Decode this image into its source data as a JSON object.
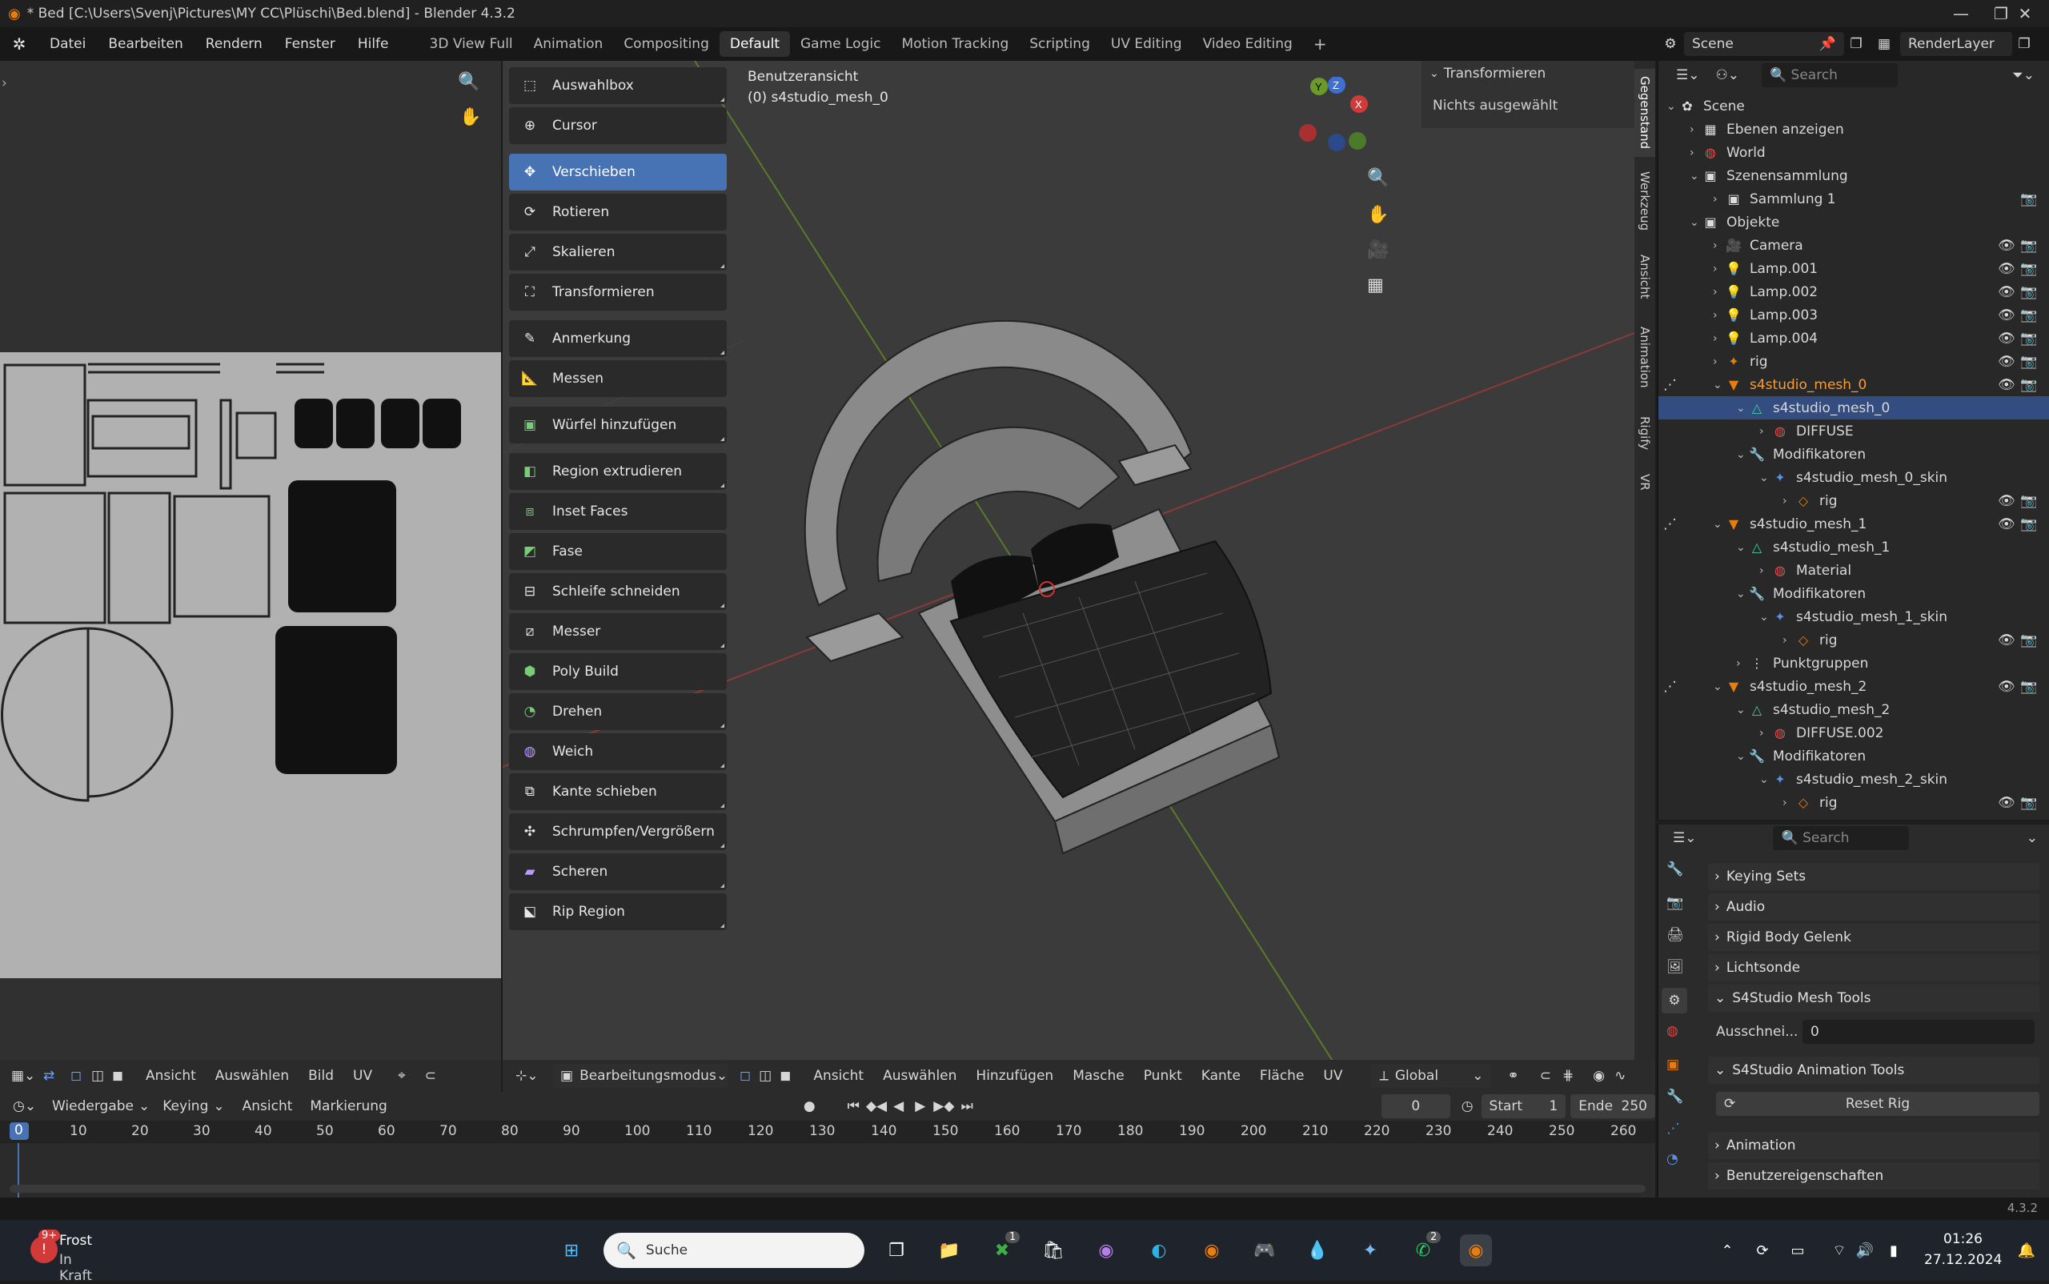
{
  "title_bar": {
    "text": "* Bed [C:\\Users\\Svenj\\Pictures\\MY CC\\Plüschi\\Bed.blend] - Blender 4.3.2"
  },
  "menu": [
    "Datei",
    "Bearbeiten",
    "Rendern",
    "Fenster",
    "Hilfe"
  ],
  "workspaces": [
    "3D View Full",
    "Animation",
    "Compositing",
    "Default",
    "Game Logic",
    "Motion Tracking",
    "Scripting",
    "UV Editing",
    "Video Editing"
  ],
  "active_workspace": "Default",
  "scene": {
    "name": "Scene",
    "render_layer": "RenderLayer"
  },
  "viewport": {
    "view_name": "Benutzeransicht",
    "object_info": "(0) s4studio_mesh_0",
    "n_panel_title": "Transformieren",
    "n_panel_text": "Nichts ausgewählt",
    "side_tabs": [
      "Gegenstand",
      "Werkzeug",
      "Ansicht",
      "Animation",
      "Rigify",
      "VR"
    ]
  },
  "tools": [
    {
      "label": "Auswahlbox",
      "icon": "select-box-icon"
    },
    {
      "label": "Cursor",
      "icon": "cursor-icon"
    },
    {
      "label": "Verschieben",
      "icon": "move-icon",
      "active": true
    },
    {
      "label": "Rotieren",
      "icon": "rotate-icon"
    },
    {
      "label": "Skalieren",
      "icon": "scale-icon"
    },
    {
      "label": "Transformieren",
      "icon": "transform-icon"
    },
    {
      "label": "Anmerkung",
      "icon": "annotate-icon"
    },
    {
      "label": "Messen",
      "icon": "measure-icon"
    },
    {
      "label": "Würfel hinzufügen",
      "icon": "add-cube-icon"
    },
    {
      "label": "Region extrudieren",
      "icon": "extrude-icon"
    },
    {
      "label": "Inset Faces",
      "icon": "inset-icon"
    },
    {
      "label": "Fase",
      "icon": "bevel-icon"
    },
    {
      "label": "Schleife schneiden",
      "icon": "loop-cut-icon"
    },
    {
      "label": "Messer",
      "icon": "knife-icon"
    },
    {
      "label": "Poly Build",
      "icon": "poly-build-icon"
    },
    {
      "label": "Drehen",
      "icon": "spin-icon"
    },
    {
      "label": "Weich",
      "icon": "smooth-icon"
    },
    {
      "label": "Kante schieben",
      "icon": "edge-slide-icon"
    },
    {
      "label": "Schrumpfen/Vergrößern",
      "icon": "shrink-fatten-icon"
    },
    {
      "label": "Scheren",
      "icon": "shear-icon"
    },
    {
      "label": "Rip Region",
      "icon": "rip-region-icon"
    }
  ],
  "uv_header": {
    "items": [
      "Ansicht",
      "Auswählen",
      "Bild",
      "UV"
    ]
  },
  "viewport_header": {
    "mode": "Bearbeitungsmodus",
    "items": [
      "Ansicht",
      "Auswählen",
      "Hinzufügen",
      "Masche",
      "Punkt",
      "Kante",
      "Fläche",
      "UV"
    ],
    "orientation": "Global"
  },
  "outliner": {
    "search_placeholder": "Search",
    "rows": [
      {
        "label": "Scene",
        "indent": 0,
        "icon": "scene"
      },
      {
        "label": "Ebenen anzeigen",
        "indent": 1,
        "icon": "layers"
      },
      {
        "label": "World",
        "indent": 1,
        "icon": "world"
      },
      {
        "label": "Szenensammlung",
        "indent": 1,
        "icon": "collection"
      },
      {
        "label": "Sammlung 1",
        "indent": 2,
        "icon": "collection"
      },
      {
        "label": "Objekte",
        "indent": 1,
        "icon": "collection"
      },
      {
        "label": "Camera",
        "indent": 2,
        "icon": "camera"
      },
      {
        "label": "Lamp.001",
        "indent": 2,
        "icon": "lamp"
      },
      {
        "label": "Lamp.002",
        "indent": 2,
        "icon": "lamp"
      },
      {
        "label": "Lamp.003",
        "indent": 2,
        "icon": "lamp"
      },
      {
        "label": "Lamp.004",
        "indent": 2,
        "icon": "lamp"
      },
      {
        "label": "rig",
        "indent": 2,
        "icon": "armature"
      },
      {
        "label": "s4studio_mesh_0",
        "indent": 2,
        "icon": "mesh",
        "highlight": true
      },
      {
        "label": "s4studio_mesh_0",
        "indent": 3,
        "icon": "meshdata",
        "selected": true
      },
      {
        "label": "DIFFUSE",
        "indent": 4,
        "icon": "material"
      },
      {
        "label": "Modifikatoren",
        "indent": 3,
        "icon": "wrench"
      },
      {
        "label": "s4studio_mesh_0_skin",
        "indent": 4,
        "icon": "modifier"
      },
      {
        "label": "rig",
        "indent": 5,
        "icon": "armdata"
      },
      {
        "label": "s4studio_mesh_1",
        "indent": 2,
        "icon": "mesh"
      },
      {
        "label": "s4studio_mesh_1",
        "indent": 3,
        "icon": "meshdata"
      },
      {
        "label": "Material",
        "indent": 4,
        "icon": "material"
      },
      {
        "label": "Modifikatoren",
        "indent": 3,
        "icon": "wrench"
      },
      {
        "label": "s4studio_mesh_1_skin",
        "indent": 4,
        "icon": "modifier"
      },
      {
        "label": "rig",
        "indent": 5,
        "icon": "armdata"
      },
      {
        "label": "Punktgruppen",
        "indent": 3,
        "icon": "groups"
      },
      {
        "label": "s4studio_mesh_2",
        "indent": 2,
        "icon": "mesh"
      },
      {
        "label": "s4studio_mesh_2",
        "indent": 3,
        "icon": "meshdata"
      },
      {
        "label": "DIFFUSE.002",
        "indent": 4,
        "icon": "material"
      },
      {
        "label": "Modifikatoren",
        "indent": 3,
        "icon": "wrench"
      },
      {
        "label": "s4studio_mesh_2_skin",
        "indent": 4,
        "icon": "modifier"
      },
      {
        "label": "rig",
        "indent": 5,
        "icon": "armdata"
      }
    ]
  },
  "properties": {
    "search_placeholder": "Search",
    "panels": [
      "Keying Sets",
      "Audio",
      "Rigid Body Gelenk",
      "Lichtsonde",
      "S4Studio Mesh Tools",
      "S4Studio Animation Tools",
      "Animation",
      "Benutzereigenschaften"
    ],
    "cut_label": "Ausschnei...",
    "cut_value": "0",
    "reset_rig": "Reset Rig"
  },
  "timeline": {
    "items": [
      "Wiedergabe",
      "Keying",
      "Ansicht",
      "Markierung"
    ],
    "current_frame": "0",
    "start_label": "Start",
    "start": "1",
    "end_label": "Ende",
    "end": "250",
    "ticks": [
      "0",
      "10",
      "20",
      "30",
      "40",
      "50",
      "60",
      "70",
      "80",
      "90",
      "100",
      "110",
      "120",
      "130",
      "140",
      "150",
      "160",
      "170",
      "180",
      "190",
      "200",
      "210",
      "220",
      "230",
      "240",
      "250",
      "260"
    ]
  },
  "status": {
    "version": "4.3.2"
  },
  "taskbar": {
    "weather_title": "Frost",
    "weather_sub": "In Kraft",
    "weather_badge": "9+",
    "search_placeholder": "Suche",
    "xbox_badge": "1",
    "whatsapp_badge": "2",
    "time": "01:26",
    "date": "27.12.2024"
  }
}
